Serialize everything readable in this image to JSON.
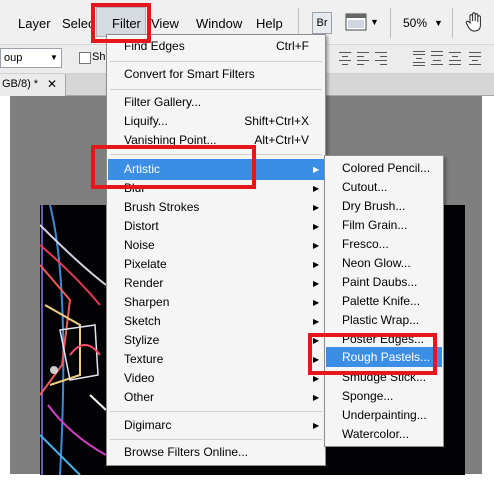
{
  "menubar": {
    "items": [
      "Layer",
      "Selec",
      "Filter",
      "View",
      "Window",
      "Help"
    ],
    "bridge_label": "Br",
    "zoom": "50%",
    "zoom_arrow": "▼",
    "hand_icon": "hand-icon"
  },
  "options_bar": {
    "select_value": "oup",
    "checkbox_label": "Sh"
  },
  "document_tab": {
    "title": "GB/8) *",
    "close": "✕"
  },
  "filter_menu": {
    "items": [
      {
        "label": "Find Edges",
        "shortcut": "Ctrl+F"
      },
      {
        "label": "Convert for Smart Filters",
        "shortcut": ""
      },
      {
        "label": "Filter Gallery...",
        "shortcut": ""
      },
      {
        "label": "Liquify...",
        "shortcut": "Shift+Ctrl+X"
      },
      {
        "label": "Vanishing Point...",
        "shortcut": "Alt+Ctrl+V"
      },
      {
        "label": "Artistic",
        "shortcut": ""
      },
      {
        "label": "Blur",
        "shortcut": ""
      },
      {
        "label": "Brush Strokes",
        "shortcut": ""
      },
      {
        "label": "Distort",
        "shortcut": ""
      },
      {
        "label": "Noise",
        "shortcut": ""
      },
      {
        "label": "Pixelate",
        "shortcut": ""
      },
      {
        "label": "Render",
        "shortcut": ""
      },
      {
        "label": "Sharpen",
        "shortcut": ""
      },
      {
        "label": "Sketch",
        "shortcut": ""
      },
      {
        "label": "Stylize",
        "shortcut": ""
      },
      {
        "label": "Texture",
        "shortcut": ""
      },
      {
        "label": "Video",
        "shortcut": ""
      },
      {
        "label": "Other",
        "shortcut": ""
      },
      {
        "label": "Digimarc",
        "shortcut": ""
      },
      {
        "label": "Browse Filters Online...",
        "shortcut": ""
      }
    ],
    "submenu_arrow": "▶"
  },
  "artistic_submenu": {
    "items": [
      "Colored Pencil...",
      "Cutout...",
      "Dry Brush...",
      "Film Grain...",
      "Fresco...",
      "Neon Glow...",
      "Paint Daubs...",
      "Palette Knife...",
      "Plastic Wrap...",
      "Poster Edges...",
      "Rough Pastels...",
      "Smudge Stick...",
      "Sponge...",
      "Underpainting...",
      "Watercolor..."
    ]
  },
  "colors": {
    "highlight": "#3a8ee6",
    "annotation_red": "#e5171c",
    "menu_bg": "#f5f5f5"
  }
}
